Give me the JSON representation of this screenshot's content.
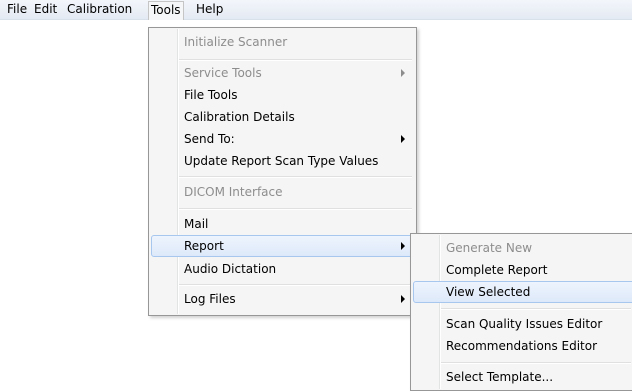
{
  "menubar": {
    "file": "File",
    "edit": "Edit",
    "calibration": "Calibration",
    "tools": "Tools",
    "help": "Help"
  },
  "tools_menu": {
    "initialize_scanner": "Initialize Scanner",
    "service_tools": "Service Tools",
    "file_tools": "File Tools",
    "calibration_details": "Calibration Details",
    "send_to": "Send To:",
    "update_report_scan_type_values": "Update Report Scan Type Values",
    "dicom_interface": "DICOM Interface",
    "mail": "Mail",
    "report": "Report",
    "audio_dictation": "Audio Dictation",
    "log_files": "Log Files"
  },
  "report_submenu": {
    "generate_new": "Generate New",
    "complete_report": "Complete Report",
    "view_selected": "View Selected",
    "scan_quality_issues_editor": "Scan Quality Issues Editor",
    "recommendations_editor": "Recommendations Editor",
    "select_template": "Select Template..."
  },
  "icons": {
    "submenu_arrow": "chevron-right-icon"
  },
  "colors": {
    "highlight_border": "#a8c7ef",
    "highlight_fill": "#dde9fa",
    "disabled_text": "#8d8d8d",
    "menu_background": "#f5f5f5"
  }
}
